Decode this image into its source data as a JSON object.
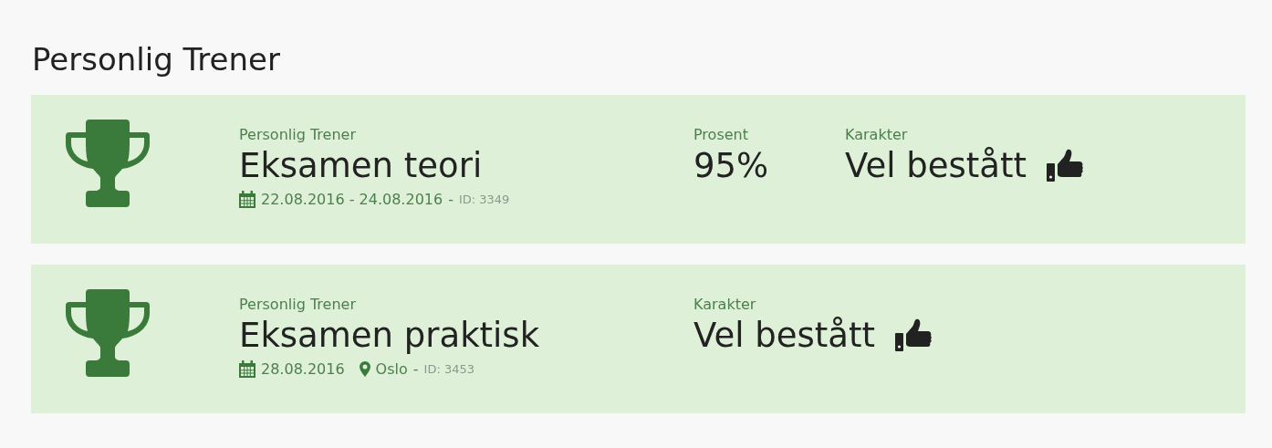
{
  "heading": "Personlig Trener",
  "results": [
    {
      "category": "Personlig Trener",
      "title": "Eksamen teori",
      "date": "22.08.2016 - 24.08.2016",
      "separator": "-",
      "id": "ID: 3349",
      "stats": [
        {
          "kind": "percent",
          "label": "Prosent",
          "value": "95%"
        },
        {
          "kind": "grade",
          "label": "Karakter",
          "value": "Vel bestått"
        }
      ]
    },
    {
      "category": "Personlig Trener",
      "title": "Eksamen praktisk",
      "date": "28.08.2016",
      "location": "Oslo",
      "separator": "-",
      "id": "ID: 3453",
      "stats": [
        {
          "kind": "grade",
          "label": "Karakter",
          "value": "Vel bestått"
        }
      ]
    }
  ]
}
